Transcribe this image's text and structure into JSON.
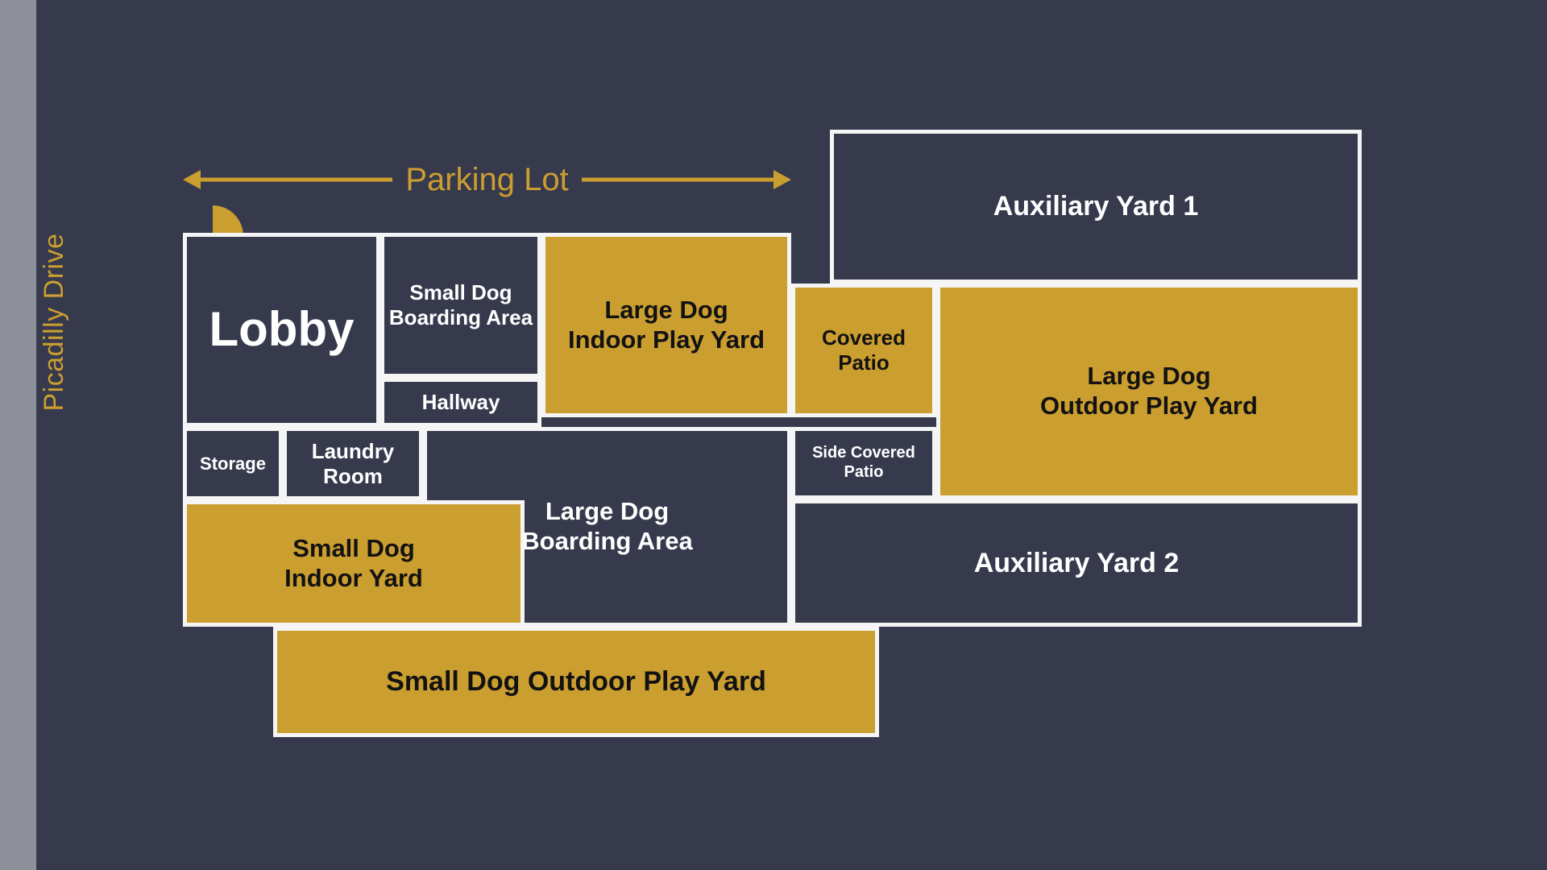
{
  "palette": {
    "background": "#373a4d",
    "gold": "#cb9e30",
    "wall": "#f5f5f5",
    "street": "#8e9099",
    "dark_text": "#121212",
    "light_text": "#ffffff"
  },
  "street": {
    "label": "Picadilly Drive"
  },
  "parking": {
    "label": "Parking Lot",
    "arrow": "double-headed-horizontal"
  },
  "door": {
    "name": "entry-door-swing"
  },
  "rooms": [
    {
      "key": "lobby",
      "label": "Lobby",
      "fill": "dark"
    },
    {
      "key": "small_dog_boarding",
      "label": "Small Dog\nBoarding Area",
      "fill": "dark"
    },
    {
      "key": "hallway",
      "label": "Hallway",
      "fill": "dark"
    },
    {
      "key": "large_dog_indoor_play",
      "label": "Large Dog\nIndoor Play Yard",
      "fill": "gold"
    },
    {
      "key": "covered_patio",
      "label": "Covered\nPatio",
      "fill": "gold"
    },
    {
      "key": "auxiliary_yard_1",
      "label": "Auxiliary Yard 1",
      "fill": "dark"
    },
    {
      "key": "large_dog_outdoor_play",
      "label": "Large Dog\nOutdoor Play Yard",
      "fill": "gold"
    },
    {
      "key": "storage",
      "label": "Storage",
      "fill": "dark"
    },
    {
      "key": "laundry_room",
      "label": "Laundry\nRoom",
      "fill": "dark"
    },
    {
      "key": "large_dog_boarding",
      "label": "Large Dog\nBoarding Area",
      "fill": "dark"
    },
    {
      "key": "side_covered_patio",
      "label": "Side Covered\nPatio",
      "fill": "dark"
    },
    {
      "key": "auxiliary_yard_2",
      "label": "Auxiliary Yard 2",
      "fill": "dark"
    },
    {
      "key": "small_dog_indoor_yard",
      "label": "Small Dog\nIndoor Yard",
      "fill": "gold"
    },
    {
      "key": "small_dog_outdoor_play",
      "label": "Small Dog Outdoor Play Yard",
      "fill": "gold"
    }
  ]
}
